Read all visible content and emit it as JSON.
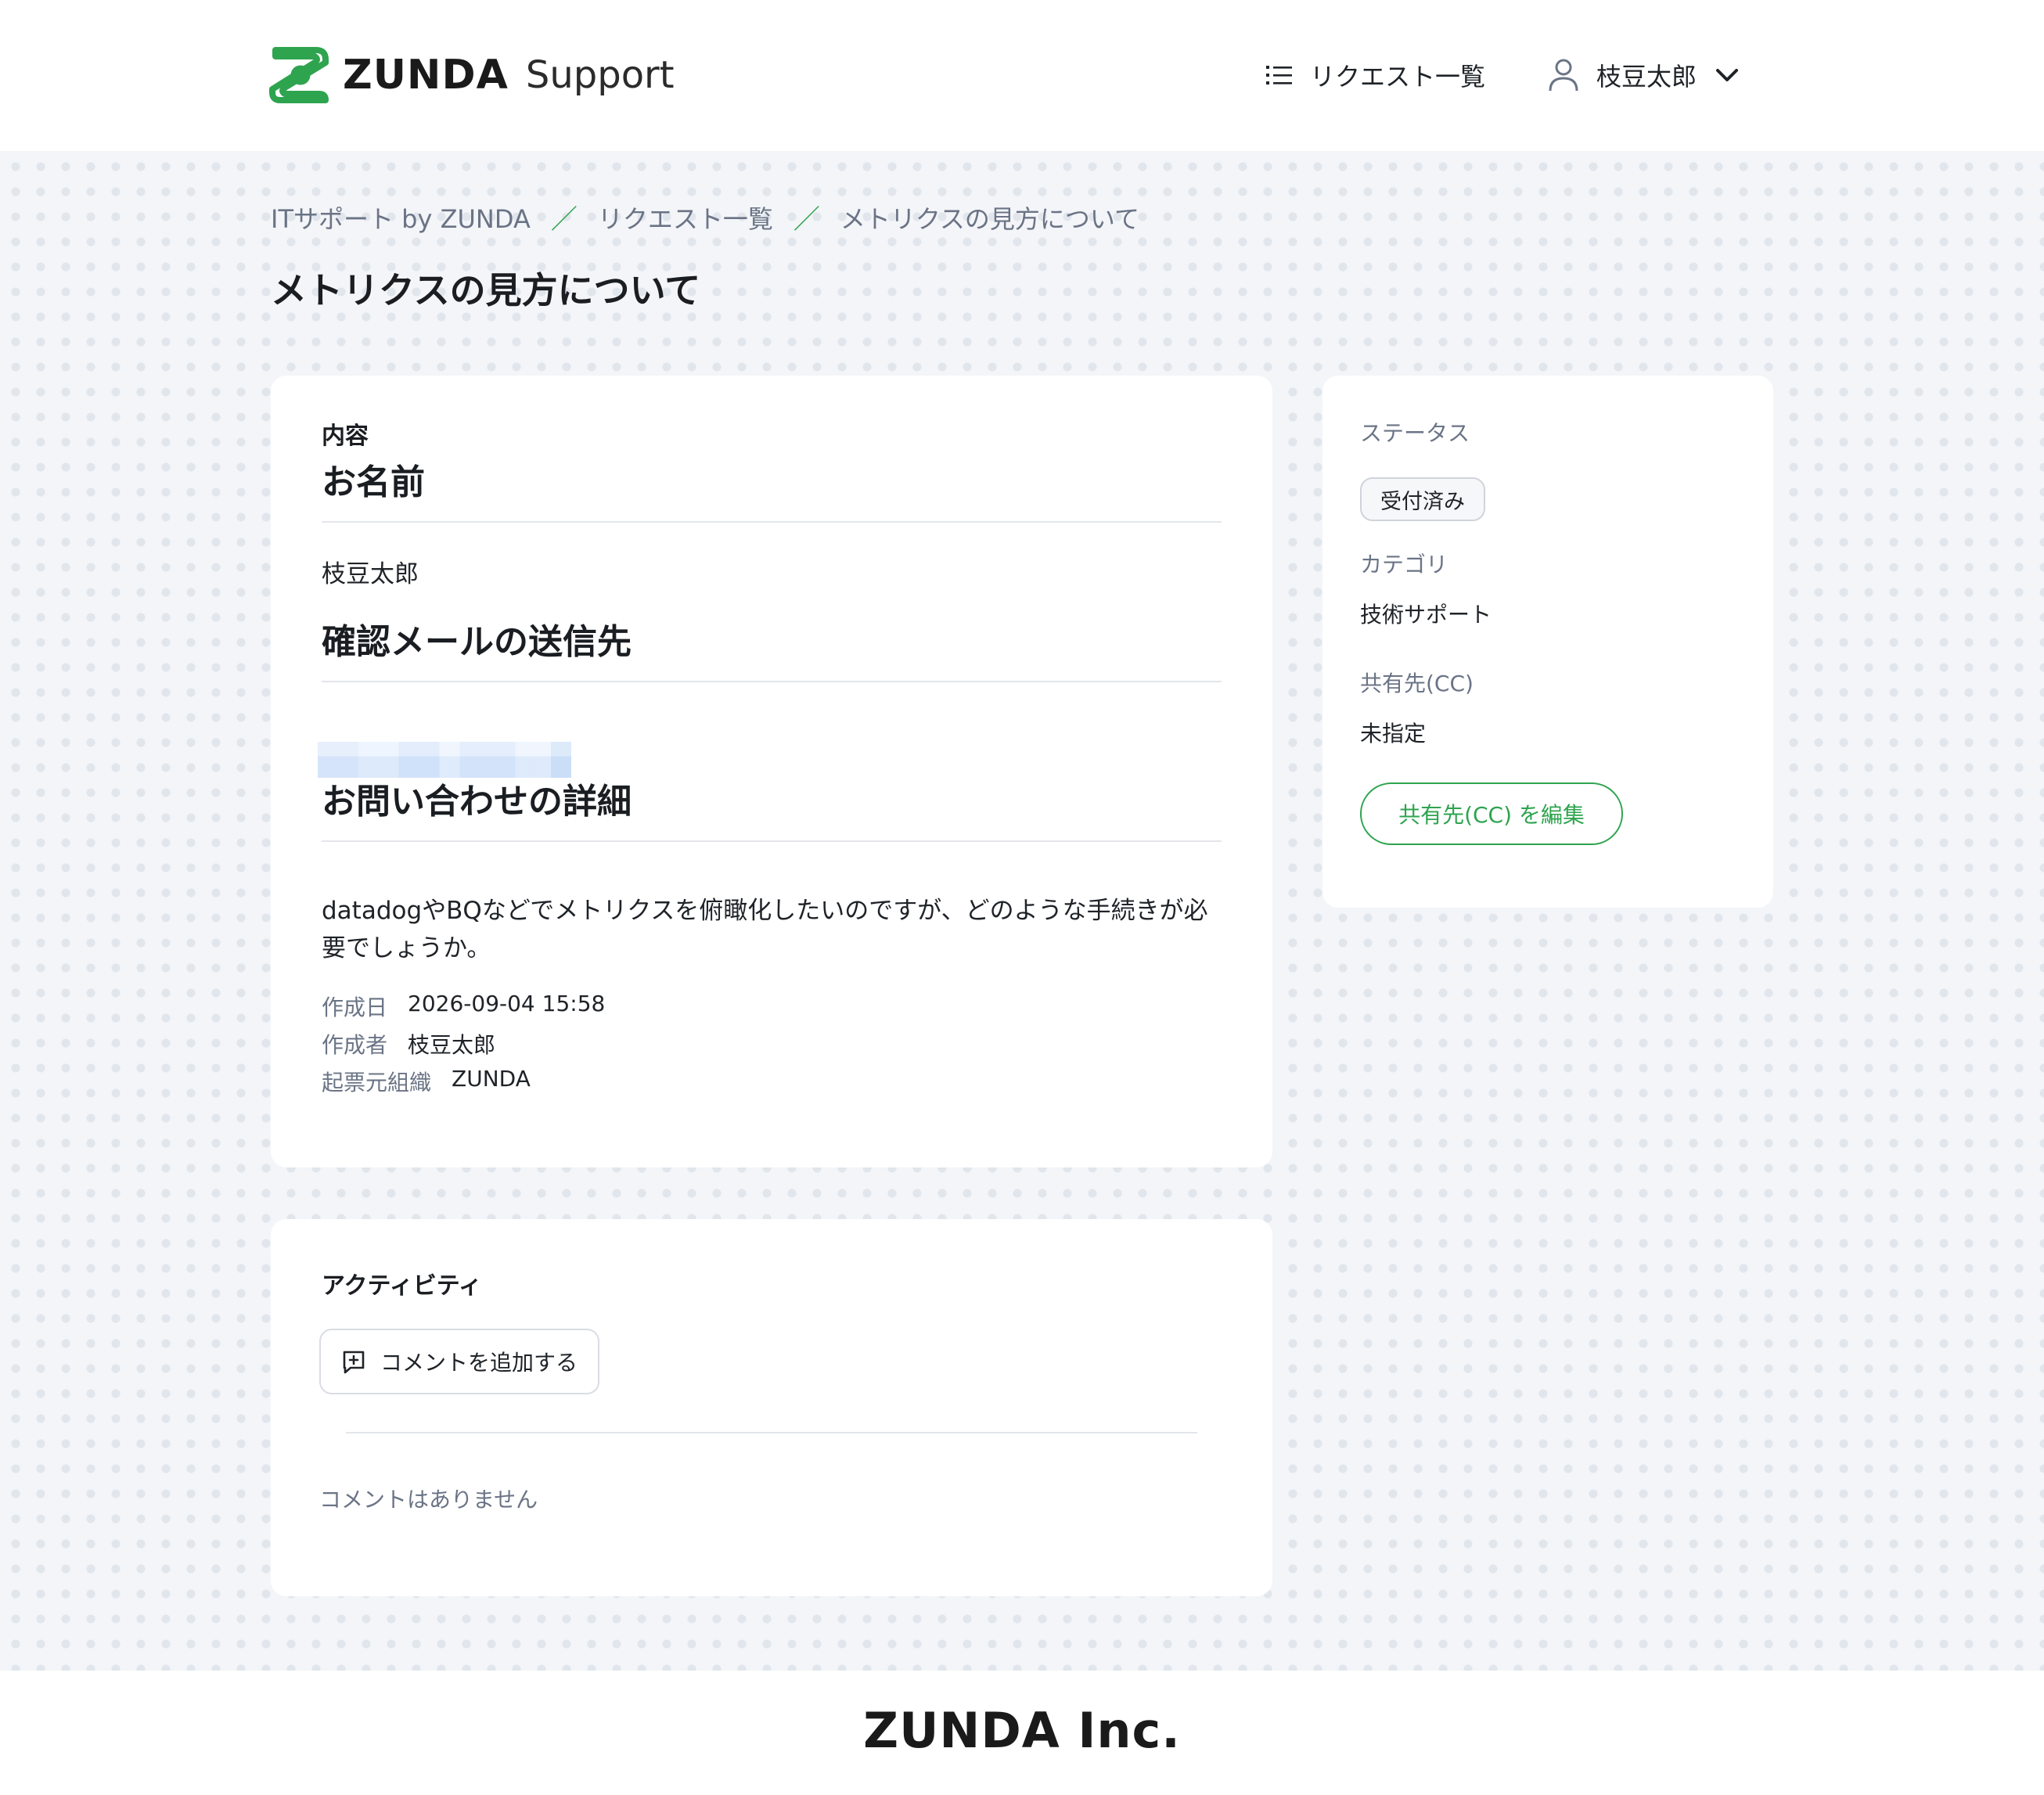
{
  "header": {
    "logo_word": "ZUNDA",
    "logo_sub": "Support",
    "nav_requests_label": "リクエスト一覧",
    "user_name": "枝豆太郎"
  },
  "breadcrumb": {
    "items": [
      "ITサポート by ZUNDA",
      "リクエスト一覧",
      "メトリクスの見方について"
    ],
    "separator": "／"
  },
  "page_title": "メトリクスの見方について",
  "content": {
    "section_label": "内容",
    "fields": [
      {
        "heading": "お名前",
        "value": "枝豆太郎"
      },
      {
        "heading": "確認メールの送信先",
        "value": ""
      },
      {
        "heading": "お問い合わせの詳細",
        "value": "datadogやBQなどでメトリクスを俯瞰化したいのですが、どのような手続きが必要でしょうか。"
      }
    ],
    "meta": [
      {
        "key": "作成日",
        "value": "2026-09-04 15:58"
      },
      {
        "key": "作成者",
        "value": "枝豆太郎"
      },
      {
        "key": "起票元組織",
        "value": "ZUNDA"
      }
    ]
  },
  "sidebar": {
    "status_label": "ステータス",
    "status_value": "受付済み",
    "category_label": "カテゴリ",
    "category_value": "技術サポート",
    "cc_label": "共有先(CC)",
    "cc_value": "未指定",
    "cc_button": "共有先(CC) を編集"
  },
  "activity": {
    "title": "アクティビティ",
    "add_comment": "コメントを追加する",
    "empty": "コメントはありません"
  },
  "footer": {
    "brand": "ZUNDA Inc."
  },
  "colors": {
    "accent": "#2ea44f",
    "muted_text": "#6b7486",
    "background": "#f3f5f8"
  }
}
